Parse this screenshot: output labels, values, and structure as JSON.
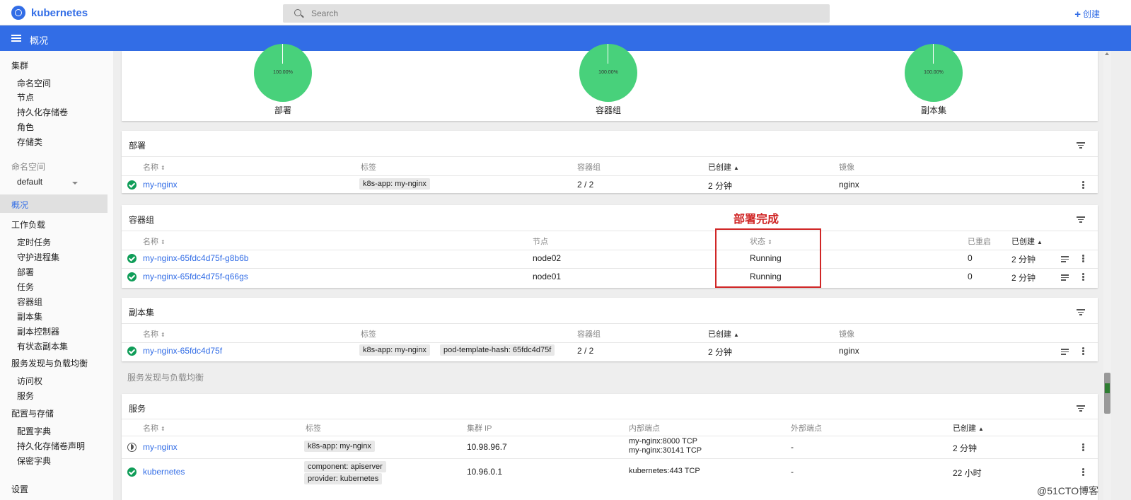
{
  "topbar": {
    "brand": "kubernetes",
    "search_placeholder": "Search",
    "create_label": "创建",
    "create_icon": "plus-icon"
  },
  "header": {
    "title": "概况"
  },
  "sidebar": {
    "cluster_title": "集群",
    "cluster_items": [
      "命名空间",
      "节点",
      "持久化存储卷",
      "角色",
      "存储类"
    ],
    "namespace_label": "命名空间",
    "namespace_selected": "default",
    "overview": "概况",
    "workloads_title": "工作负载",
    "workload_items": [
      "定时任务",
      "守护进程集",
      "部署",
      "任务",
      "容器组",
      "副本集",
      "副本控制器",
      "有状态副本集"
    ],
    "discovery_title": "服务发现与负载均衡",
    "discovery_items": [
      "访问权",
      "服务"
    ],
    "config_title": "配置与存储",
    "config_items": [
      "配置字典",
      "持久化存储卷声明",
      "保密字典"
    ],
    "settings_title": "设置"
  },
  "charts": [
    {
      "label": "部署",
      "percent": "100.00%"
    },
    {
      "label": "容器组",
      "percent": "100.00%"
    },
    {
      "label": "副本集",
      "percent": "100.00%"
    }
  ],
  "deployments": {
    "title": "部署",
    "headers": {
      "name": "名称",
      "labels": "标签",
      "pods": "容器组",
      "created": "已创建",
      "images": "镜像"
    },
    "rows": [
      {
        "name": "my-nginx",
        "labels": [
          "k8s-app: my-nginx"
        ],
        "pods": "2 / 2",
        "created": "2 分钟",
        "images": "nginx",
        "status": "ok"
      }
    ]
  },
  "pods": {
    "title": "容器组",
    "headers": {
      "name": "名称",
      "node": "节点",
      "status": "状态",
      "restarts": "已重启",
      "created": "已创建"
    },
    "rows": [
      {
        "name": "my-nginx-65fdc4d75f-g8b6b",
        "node": "node02",
        "status": "Running",
        "restarts": "0",
        "created": "2 分钟"
      },
      {
        "name": "my-nginx-65fdc4d75f-q66gs",
        "node": "node01",
        "status": "Running",
        "restarts": "0",
        "created": "2 分钟"
      }
    ]
  },
  "replicasets": {
    "title": "副本集",
    "headers": {
      "name": "名称",
      "labels": "标签",
      "pods": "容器组",
      "created": "已创建",
      "images": "镜像"
    },
    "rows": [
      {
        "name": "my-nginx-65fdc4d75f",
        "labels": [
          "k8s-app: my-nginx",
          "pod-template-hash: 65fdc4d75f"
        ],
        "pods": "2 / 2",
        "created": "2 分钟",
        "images": "nginx"
      }
    ]
  },
  "discovery_section": "服务发现与负载均衡",
  "services": {
    "title": "服务",
    "headers": {
      "name": "名称",
      "labels": "标签",
      "cluster_ip": "集群 IP",
      "internal": "内部端点",
      "external": "外部端点",
      "created": "已创建"
    },
    "rows": [
      {
        "name": "my-nginx",
        "labels": [
          "k8s-app: my-nginx"
        ],
        "cluster_ip": "10.98.96.7",
        "internal": [
          "my-nginx:8000 TCP",
          "my-nginx:30141 TCP"
        ],
        "external": "-",
        "created": "2 分钟",
        "status": "pending"
      },
      {
        "name": "kubernetes",
        "labels": [
          "component: apiserver",
          "provider: kubernetes"
        ],
        "cluster_ip": "10.96.0.1",
        "internal": [
          "kubernetes:443 TCP"
        ],
        "external": "-",
        "created": "22 小时",
        "status": "ok"
      }
    ]
  },
  "annotation": {
    "text": "部署完成",
    "color": "#d02626"
  },
  "watermark": "@51CTO博客",
  "colors": {
    "accent": "#326de6",
    "ok": "#0f9d58",
    "donut": "#48d17b"
  }
}
